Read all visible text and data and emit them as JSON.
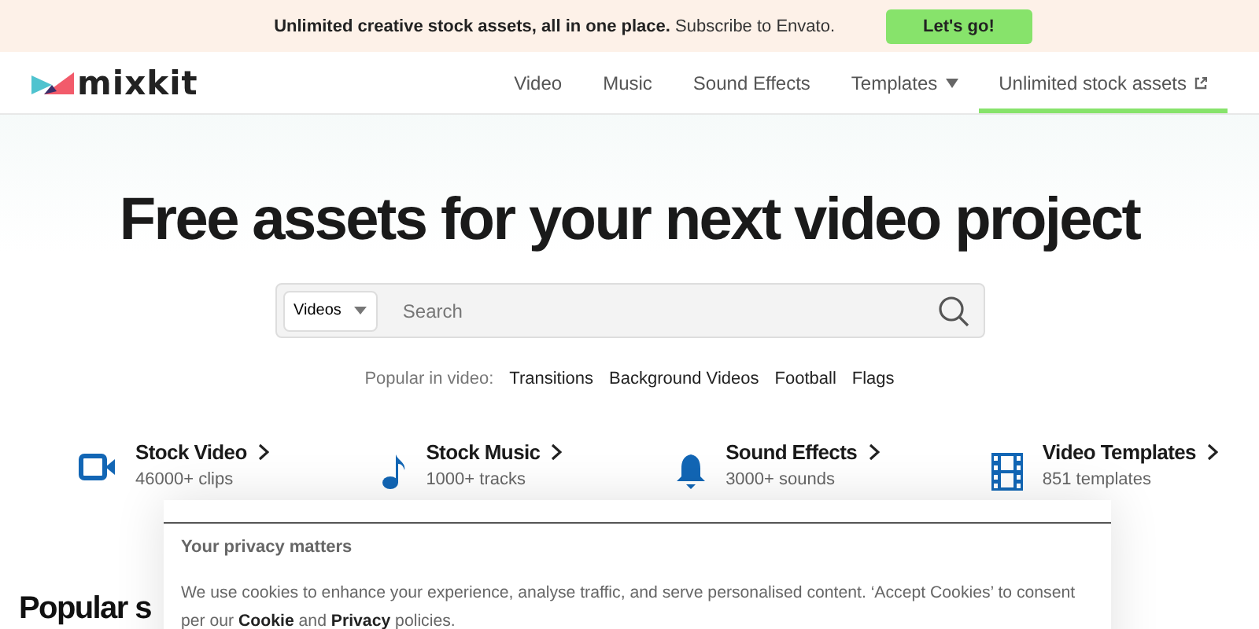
{
  "banner": {
    "text": "**Unlimited creative stock assets, all in one place.** Subscribe to Envato.",
    "button": "Let's go!"
  },
  "header": {
    "logo": "mixkit",
    "nav": [
      {
        "label": "Video",
        "selected": false,
        "kind": "link"
      },
      {
        "label": "Music",
        "selected": false,
        "kind": "link"
      },
      {
        "label": "Sound Effects",
        "selected": false,
        "kind": "link"
      },
      {
        "label": "Templates",
        "selected": false,
        "kind": "dropdown"
      },
      {
        "label": "Unlimited stock assets",
        "selected": true,
        "kind": "external"
      }
    ]
  },
  "hero": {
    "title": "Free assets for your next video project",
    "search": {
      "category": "Videos",
      "placeholder": "Search"
    },
    "popular": {
      "label": "Popular in video:",
      "links": [
        "Transitions",
        "Background Videos",
        "Football",
        "Flags"
      ]
    }
  },
  "categories": [
    {
      "kind": "video",
      "title": "Stock Video",
      "count": "46000+ clips"
    },
    {
      "kind": "music",
      "title": "Stock Music",
      "count": "1000+ tracks"
    },
    {
      "kind": "sound",
      "title": "Sound Effects",
      "count": "3000+ sounds"
    },
    {
      "kind": "template",
      "title": "Video Templates",
      "count": "851 templates"
    }
  ],
  "section_heading": "Popular s",
  "cookie_dialog": {
    "title": "Your privacy matters",
    "text": "We use cookies to enhance your experience, analyse traffic, and serve personalised content. ‘Accept Cookies’ to consent per our **Cookie** and **Privacy** policies."
  }
}
